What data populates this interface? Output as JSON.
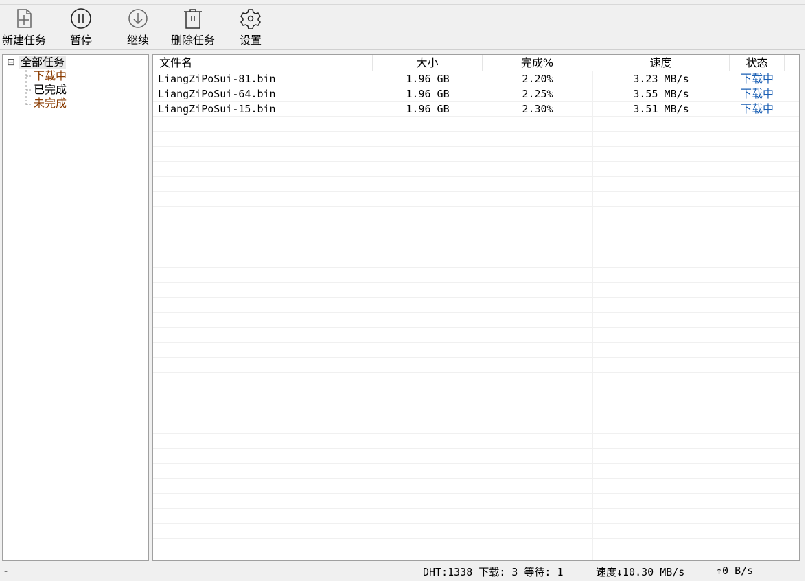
{
  "toolbar": {
    "items": [
      {
        "label": "新建任务",
        "icon": "new-file-icon"
      },
      {
        "label": "暂停",
        "icon": "pause-icon"
      },
      {
        "label": "继续",
        "icon": "download-icon"
      },
      {
        "label": "删除任务",
        "icon": "trash-icon"
      },
      {
        "label": "设置",
        "icon": "gear-icon"
      }
    ]
  },
  "tree": {
    "root": "全部任务",
    "expander": "⊟",
    "children": [
      "下载中",
      "已完成",
      "未完成"
    ]
  },
  "table": {
    "columns": [
      "文件名",
      "大小",
      "完成%",
      "速度",
      "状态"
    ],
    "rows": [
      {
        "name": "LiangZiPoSui-81.bin",
        "size": "1.96 GB",
        "pct": "2.20%",
        "speed": "3.23 MB/s",
        "status": "下载中"
      },
      {
        "name": "LiangZiPoSui-64.bin",
        "size": "1.96 GB",
        "pct": "2.25%",
        "speed": "3.55 MB/s",
        "status": "下载中"
      },
      {
        "name": "LiangZiPoSui-15.bin",
        "size": "1.96 GB",
        "pct": "2.30%",
        "speed": "3.51 MB/s",
        "status": "下载中"
      }
    ]
  },
  "statusbar": {
    "left": "-",
    "dht": "DHT:1338 下载: 3 等待: 1",
    "speed": "速度↓10.30 MB/s",
    "upload": "↑0 B/s"
  },
  "colors": {
    "status_text": "#1a5fb4",
    "tree_child": "#8a3b00"
  }
}
